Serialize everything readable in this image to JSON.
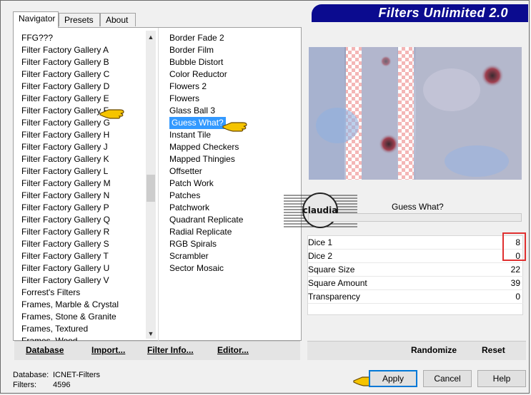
{
  "app": {
    "title": "Filters Unlimited 2.0"
  },
  "tabs": [
    {
      "label": "Navigator",
      "active": true
    },
    {
      "label": "Presets",
      "active": false
    },
    {
      "label": "About",
      "active": false
    }
  ],
  "categories": [
    "FFG???",
    "Filter Factory Gallery A",
    "Filter Factory Gallery B",
    "Filter Factory Gallery C",
    "Filter Factory Gallery D",
    "Filter Factory Gallery E",
    "Filter Factory Gallery F",
    "Filter Factory Gallery G",
    "Filter Factory Gallery H",
    "Filter Factory Gallery J",
    "Filter Factory Gallery K",
    "Filter Factory Gallery L",
    "Filter Factory Gallery M",
    "Filter Factory Gallery N",
    "Filter Factory Gallery P",
    "Filter Factory Gallery Q",
    "Filter Factory Gallery R",
    "Filter Factory Gallery S",
    "Filter Factory Gallery T",
    "Filter Factory Gallery U",
    "Filter Factory Gallery V",
    "Forrest's Filters",
    "Frames, Marble & Crystal",
    "Frames, Stone & Granite",
    "Frames, Textured",
    "Frames, Wood"
  ],
  "selected_category": "Filter Factory Gallery F",
  "filters": [
    "Border Fade 2",
    "Border Film",
    "Bubble Distort",
    "Color Reductor",
    "Flowers 2",
    "Flowers",
    "Glass Ball 3",
    "Guess What?",
    "Instant Tile",
    "Mapped Checkers",
    "Mapped Thingies",
    "Offsetter",
    "Patch Work",
    "Patches",
    "Patchwork",
    "Quadrant Replicate",
    "Radial Replicate",
    "RGB Spirals",
    "Scrambler",
    "Sector Mosaic"
  ],
  "selected_filter": "Guess What?",
  "left_buttons": {
    "database": "Database",
    "import": "Import...",
    "filter_info": "Filter Info...",
    "editor": "Editor..."
  },
  "right_panel": {
    "filter_name": "Guess What?",
    "params": [
      {
        "name": "Dice 1",
        "value": "8"
      },
      {
        "name": "Dice 2",
        "value": "0"
      },
      {
        "name": "Square Size",
        "value": "22"
      },
      {
        "name": "Square Amount",
        "value": "39"
      },
      {
        "name": "Transparency",
        "value": "0"
      }
    ],
    "randomize": "Randomize",
    "reset": "Reset"
  },
  "info": {
    "database_label": "Database:",
    "database_value": "ICNET-Filters",
    "filters_label": "Filters:",
    "filters_value": "4596"
  },
  "dialog_buttons": {
    "apply": "Apply",
    "cancel": "Cancel",
    "help": "Help"
  },
  "watermark": "claudia",
  "colors": {
    "banner": "#0b0b8f",
    "selection": "#3399ff",
    "highlight": "#e03030",
    "hand": "#f5c400"
  }
}
